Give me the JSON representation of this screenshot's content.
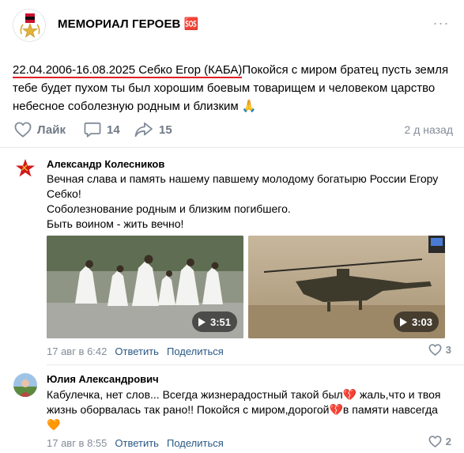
{
  "group": {
    "name": "МЕМОРИАЛ ГЕРОЕВ 🆘"
  },
  "post": {
    "text_date": "22.04.2006-16.08.2025 Себко Егор (КАБА)",
    "text_rest": "Покойся с миром братец пусть земля тебе будет пухом ты был хорошим боевым товарищем и человеком царство небесное соболезную родным и близким",
    "text_emoji": "🙏",
    "like_label": "Лайк",
    "comments_count": "14",
    "reposts_count": "15",
    "time": "2 д назад"
  },
  "comments": [
    {
      "author": "Александр Колесников",
      "lines": [
        "Вечная слава и память нашему павшему молодому богатырю России Егору Себко!",
        "Соболезнование родным и близким погибшего.",
        "Быть воином - жить вечно!"
      ],
      "videos": [
        {
          "duration": "3:51"
        },
        {
          "duration": "3:03"
        }
      ],
      "date": "17 авг в 6:42",
      "reply_label": "Ответить",
      "share_label": "Поделиться",
      "likes": "3"
    },
    {
      "author": "Юлия Александрович",
      "text": "Кабулечка, нет слов... Всегда жизнерадостный такой был💔 жаль,что и твоя жизнь оборвалась так рано!! Покойся с миром,дорогой💔в памяти навсегда 🧡",
      "date": "17 авг в 8:55",
      "reply_label": "Ответить",
      "share_label": "Поделиться",
      "likes": "2"
    }
  ],
  "colors": {
    "accent_link": "#2a5885",
    "underline": "#e0202a",
    "muted": "#818c99"
  }
}
